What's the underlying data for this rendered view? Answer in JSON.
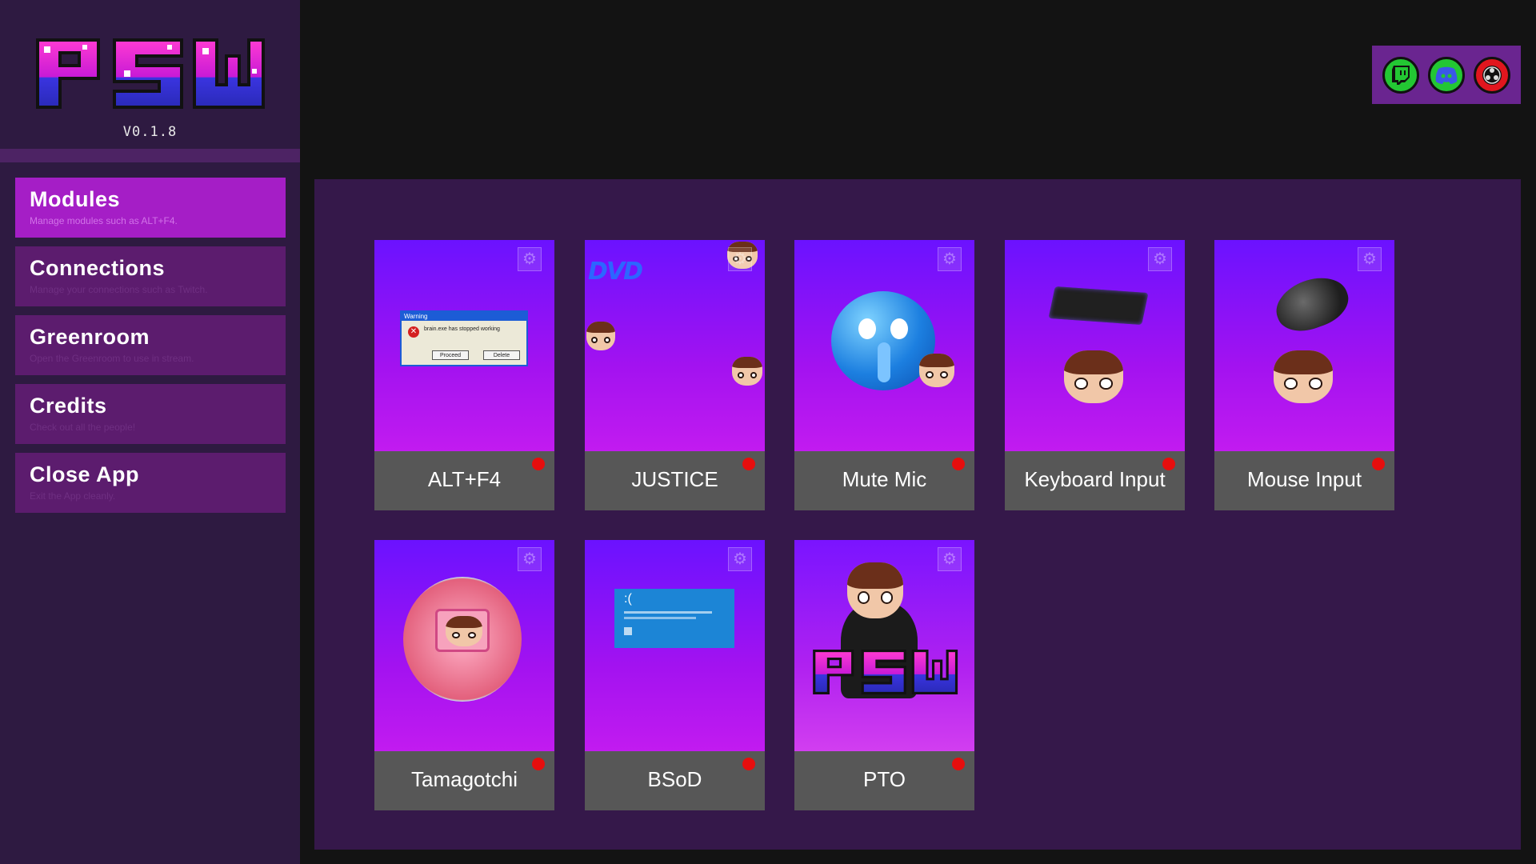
{
  "app": {
    "version": "V0.1.8",
    "logo_text": "PSW"
  },
  "sidebar": {
    "items": [
      {
        "title": "Modules",
        "subtitle": "Manage modules such as ALT+F4.",
        "active": true
      },
      {
        "title": "Connections",
        "subtitle": "Manage your connections such as Twitch.",
        "active": false
      },
      {
        "title": "Greenroom",
        "subtitle": "Open the Greenroom to use in stream.",
        "active": false
      },
      {
        "title": "Credits",
        "subtitle": "Check out all the people!",
        "active": false
      },
      {
        "title": "Close App",
        "subtitle": "Exit the App cleanly.",
        "active": false
      }
    ]
  },
  "connections": [
    {
      "icon": "twitch-icon",
      "status": "connected",
      "color": "#23c733"
    },
    {
      "icon": "discord-icon",
      "status": "connected",
      "color": "#23c733"
    },
    {
      "icon": "obs-icon",
      "status": "disconnected",
      "color": "#e1161e"
    }
  ],
  "modules": [
    {
      "name": "ALT+F4",
      "icon": "warning-dialog-icon",
      "status_color": "#e60e0e"
    },
    {
      "name": "JUSTICE",
      "icon": "dvd-logo-icon",
      "status_color": "#e60e0e"
    },
    {
      "name": "Mute Mic",
      "icon": "shushing-face-icon",
      "status_color": "#e60e0e"
    },
    {
      "name": "Keyboard Input",
      "icon": "keyboard-icon",
      "status_color": "#e60e0e"
    },
    {
      "name": "Mouse Input",
      "icon": "mouse-icon",
      "status_color": "#e60e0e"
    },
    {
      "name": "Tamagotchi",
      "icon": "tamagotchi-icon",
      "status_color": "#e60e0e"
    },
    {
      "name": "BSoD",
      "icon": "bsod-screen-icon",
      "status_color": "#e60e0e"
    },
    {
      "name": "PTO",
      "icon": "character-logo-icon",
      "status_color": "#e60e0e"
    }
  ],
  "art_text": {
    "warning_title": "Warning",
    "warning_msg": "brain.exe has stopped working",
    "warning_proceed": "Proceed",
    "warning_delete": "Delete",
    "dvd": "DVD",
    "bsod_face": ":("
  },
  "colors": {
    "accent_active": "#a51ec6",
    "nav_item": "#5c1c6e",
    "panel": "#35184a",
    "status_off": "#e60e0e"
  }
}
